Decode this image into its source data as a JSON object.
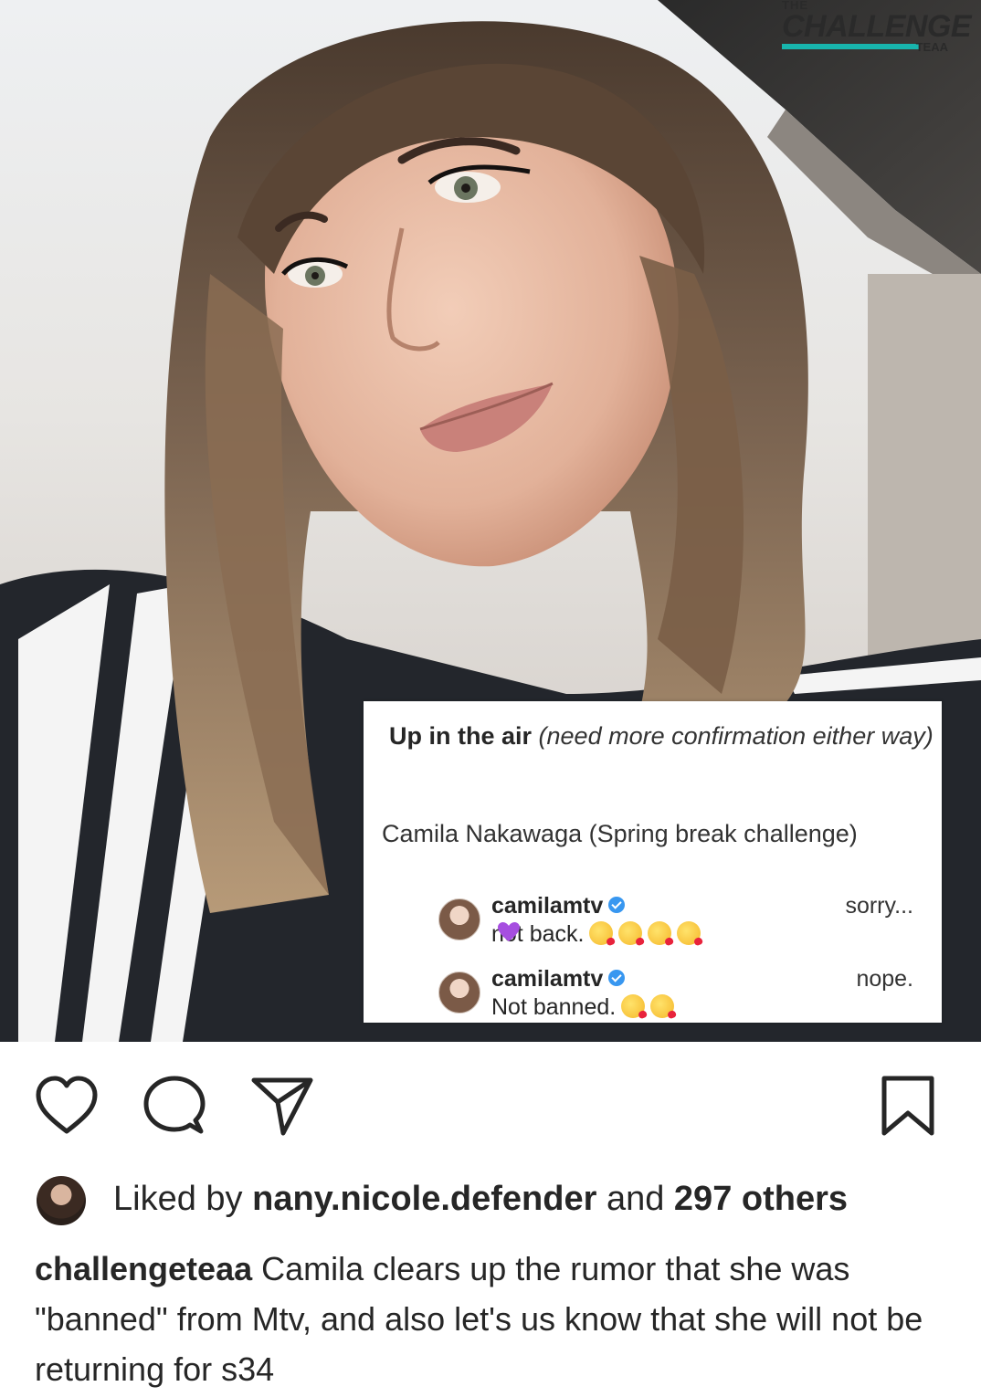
{
  "overlay_logo": {
    "top": "THE",
    "main": "CHALLENGE",
    "bottom": "TEAA"
  },
  "comment_card": {
    "heading_bold": "Up in the air",
    "heading_italic": "(need more confirmation either way)",
    "person": "Camila Nakawaga (Spring break challenge)",
    "comments": [
      {
        "username": "camilamtv",
        "text": "not back.",
        "right": "sorry..."
      },
      {
        "username": "camilamtv",
        "text": "Not banned.",
        "right": "nope."
      }
    ]
  },
  "actions": {
    "like_icon": "heart-outline-icon",
    "comment_icon": "comment-bubble-icon",
    "share_icon": "paper-plane-icon",
    "save_icon": "bookmark-outline-icon"
  },
  "likes": {
    "prefix": "Liked by",
    "user": "nany.nicole.defender",
    "middle": "and",
    "count": "297 others"
  },
  "caption": {
    "username": "challengeteaa",
    "text": "Camila clears up the rumor that she was \"banned\" from Mtv, and also let's us know that she will not be returning for s34"
  },
  "colors": {
    "accent_teal": "#18b5ad",
    "verified_blue": "#3897f0",
    "text": "#262626"
  }
}
